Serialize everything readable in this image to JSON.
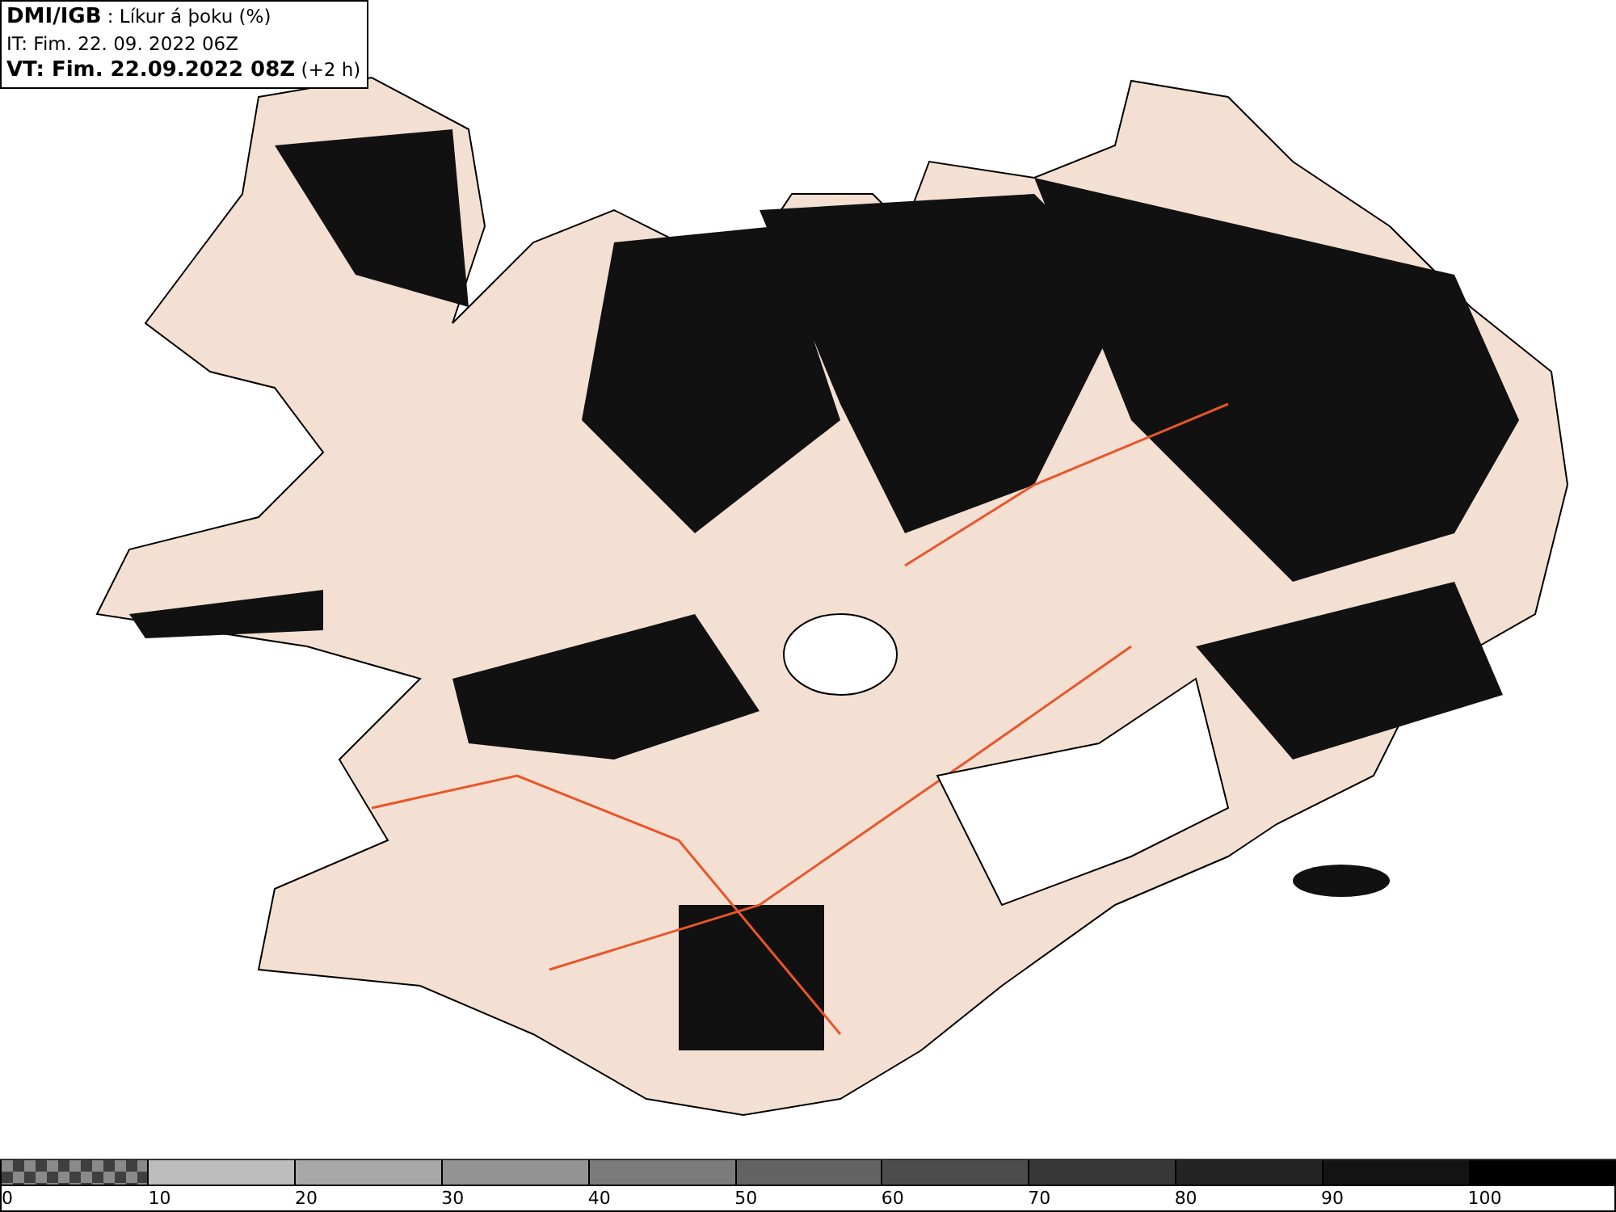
{
  "header": {
    "lines": [
      "**DMI/IGB** : Líkur á þoku (%)",
      "IT: Fim. 22. 09. 2022 06Z",
      "**VT: Fim. 22.09.2022 08Z** (+2 h)"
    ]
  },
  "legend": {
    "segments": [
      {
        "kind": "checker",
        "color": "#8a8a8a"
      },
      {
        "kind": "solid",
        "color": "#bdbdbd"
      },
      {
        "kind": "solid",
        "color": "#a8a8a8"
      },
      {
        "kind": "solid",
        "color": "#939393"
      },
      {
        "kind": "solid",
        "color": "#7b7b7b"
      },
      {
        "kind": "solid",
        "color": "#636363"
      },
      {
        "kind": "solid",
        "color": "#4c4c4c"
      },
      {
        "kind": "solid",
        "color": "#373737"
      },
      {
        "kind": "solid",
        "color": "#242424"
      },
      {
        "kind": "solid",
        "color": "#131313"
      },
      {
        "kind": "solid",
        "color": "#000000"
      }
    ],
    "labels": [
      "0",
      "10",
      "20",
      "30",
      "40",
      "50",
      "60",
      "70",
      "80",
      "90",
      "100"
    ]
  }
}
